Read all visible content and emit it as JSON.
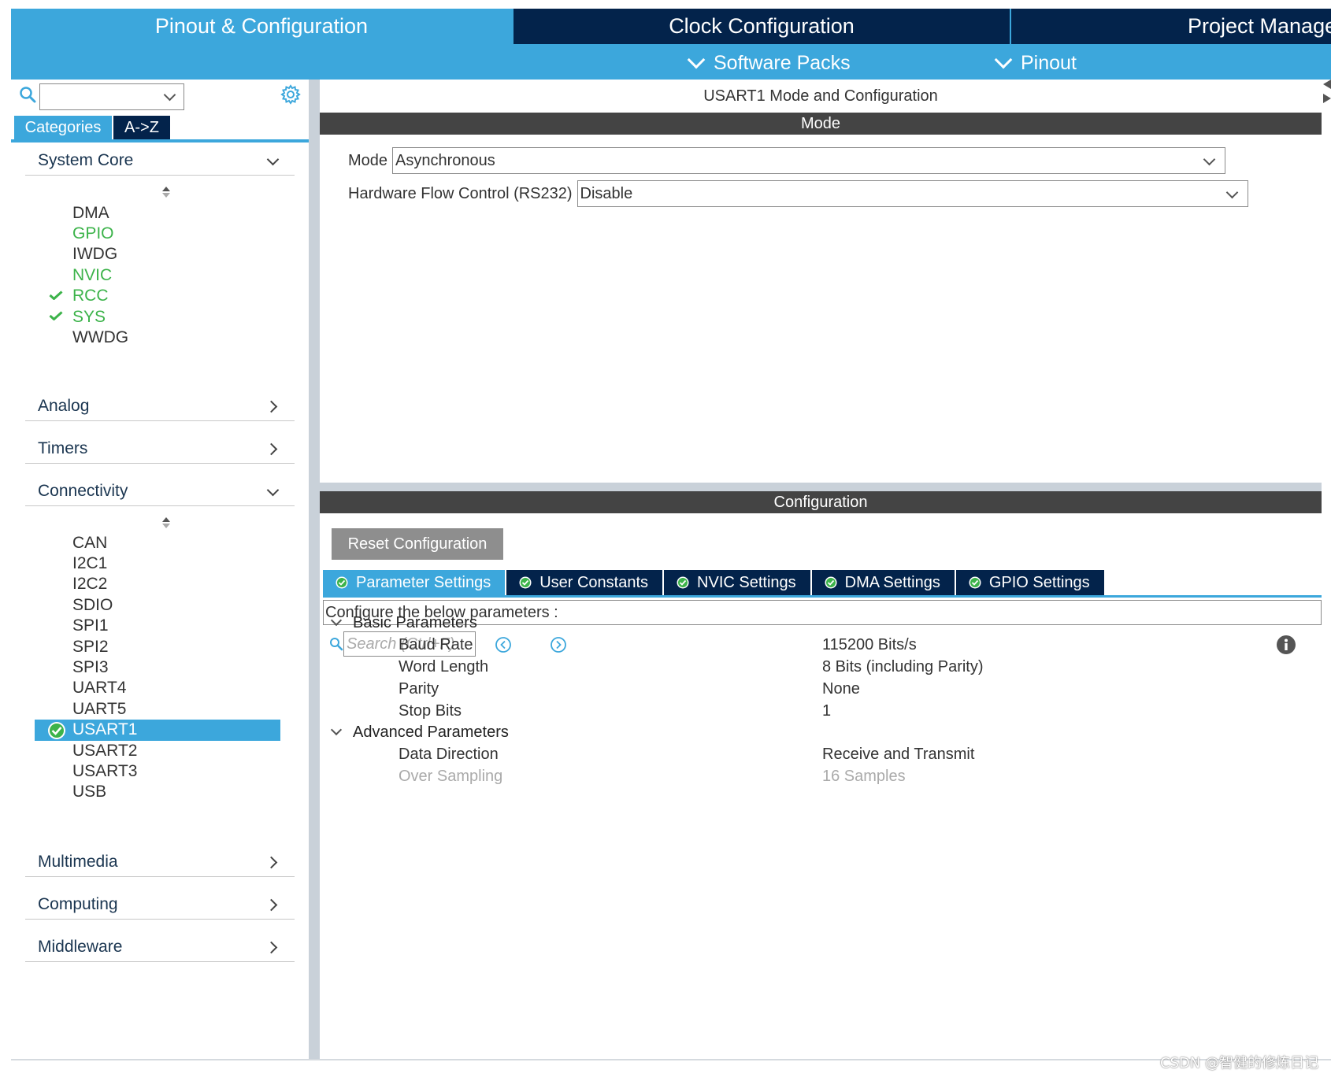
{
  "top_tabs": {
    "pinout": "Pinout & Configuration",
    "clock": "Clock Configuration",
    "project": "Project Manage",
    "software_packs": "Software Packs",
    "pinout_menu": "Pinout"
  },
  "sidebar": {
    "search_value": "",
    "tab_categories": "Categories",
    "tab_az": "A->Z",
    "system_core": {
      "label": "System Core",
      "items": [
        {
          "label": "DMA",
          "state": "normal"
        },
        {
          "label": "GPIO",
          "state": "green"
        },
        {
          "label": "IWDG",
          "state": "normal"
        },
        {
          "label": "NVIC",
          "state": "green"
        },
        {
          "label": "RCC",
          "state": "checked"
        },
        {
          "label": "SYS",
          "state": "checked"
        },
        {
          "label": "WWDG",
          "state": "normal"
        }
      ]
    },
    "analog": "Analog",
    "timers": "Timers",
    "connectivity": {
      "label": "Connectivity",
      "items": [
        {
          "label": "CAN"
        },
        {
          "label": "I2C1"
        },
        {
          "label": "I2C2"
        },
        {
          "label": "SDIO"
        },
        {
          "label": "SPI1"
        },
        {
          "label": "SPI2"
        },
        {
          "label": "SPI3"
        },
        {
          "label": "UART4"
        },
        {
          "label": "UART5"
        },
        {
          "label": "USART1",
          "selected": true
        },
        {
          "label": "USART2"
        },
        {
          "label": "USART3"
        },
        {
          "label": "USB"
        }
      ]
    },
    "multimedia": "Multimedia",
    "computing": "Computing",
    "middleware": "Middleware"
  },
  "main": {
    "title": "USART1 Mode and Configuration",
    "mode_band": "Mode",
    "mode_label": "Mode",
    "mode_value": "Asynchronous",
    "flow_label": "Hardware Flow Control (RS232)",
    "flow_value": "Disable",
    "config_band": "Configuration",
    "reset_button": "Reset Configuration",
    "tabs": [
      "Parameter Settings",
      "User Constants",
      "NVIC Settings",
      "DMA Settings",
      "GPIO Settings"
    ],
    "prompt": "Configure the below parameters :",
    "search_placeholder": "Search (Ctrl+F)",
    "basic_group": "Basic Parameters",
    "advanced_group": "Advanced Parameters",
    "params": [
      {
        "name": "Baud Rate",
        "value": "115200 Bits/s"
      },
      {
        "name": "Word Length",
        "value": "8 Bits (including Parity)"
      },
      {
        "name": "Parity",
        "value": "None"
      },
      {
        "name": "Stop Bits",
        "value": "1"
      },
      {
        "name": "Data Direction",
        "value": "Receive and Transmit"
      },
      {
        "name": "Over Sampling",
        "value": "16 Samples"
      }
    ]
  },
  "watermark": "CSDN @智健的修炼日记",
  "colors": {
    "accent": "#3ca7dc",
    "dark_tab": "#03234b",
    "band": "#444444",
    "enabled_green": "#3cb34a"
  }
}
